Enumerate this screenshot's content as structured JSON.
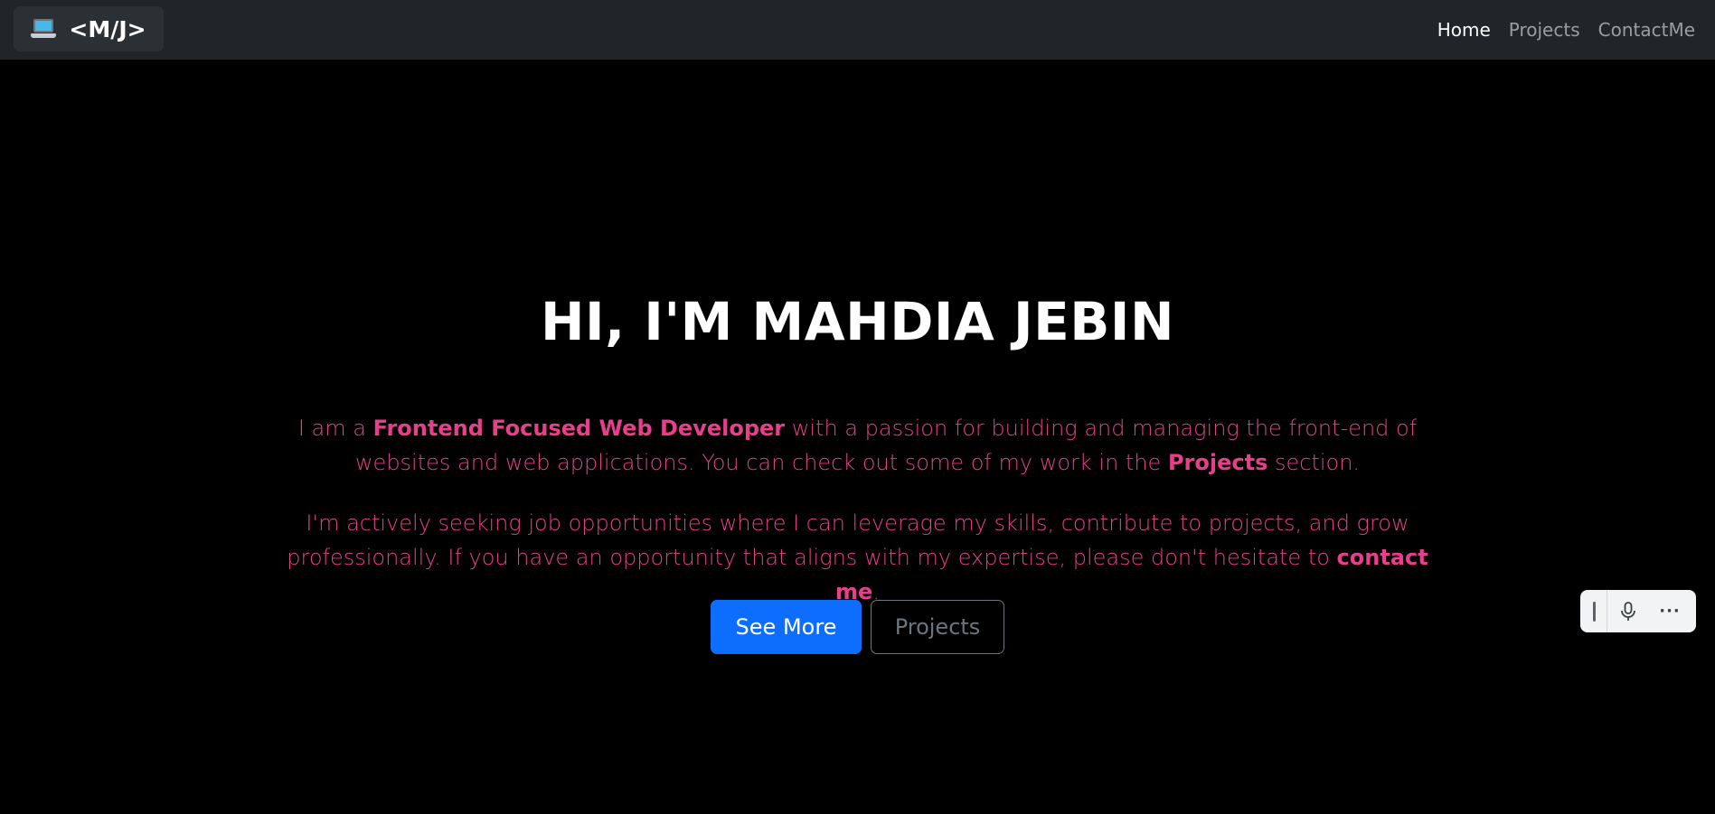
{
  "navbar": {
    "brand": {
      "icon": "laptop-icon",
      "label": "<M/J>"
    },
    "links": [
      {
        "label": "Home",
        "active": true
      },
      {
        "label": "Projects",
        "active": false
      },
      {
        "label": "ContactMe",
        "active": false
      }
    ]
  },
  "hero": {
    "title": "HI, I'M MAHDIA JEBIN",
    "para1": {
      "t1": "I am a ",
      "b1": "Frontend Focused Web Developer",
      "t2": " with a passion for building and managing the front-end of websites and web applications. You can check out some of my work in the ",
      "b2": "Projects",
      "t3": " section."
    },
    "para2": {
      "t1": "I'm actively seeking job opportunities where I can leverage my skills, contribute to projects, and grow professionally. If you have an opportunity that aligns with my expertise, please don't hesitate to ",
      "b1": "contact me",
      "t2": "."
    },
    "buttons": {
      "primary": "See More",
      "secondary": "Projects"
    }
  },
  "voice_toolbar": {
    "icons": [
      "drag-handle-icon",
      "microphone-icon",
      "more-icon"
    ],
    "more_glyph": "···"
  },
  "colors": {
    "accent_text": "#e83e8c",
    "primary_button": "#0d6efd",
    "navbar_bg": "#212529",
    "page_bg": "#000000"
  }
}
